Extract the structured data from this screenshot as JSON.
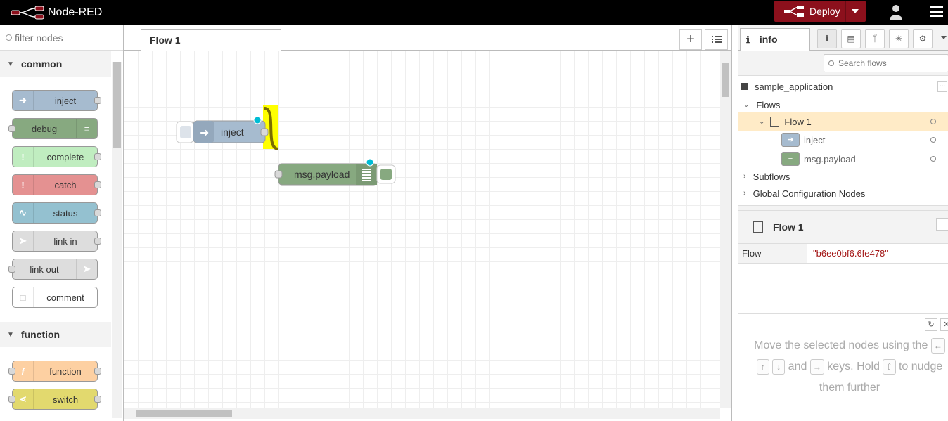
{
  "header": {
    "app_title": "Node-RED",
    "deploy_label": "Deploy"
  },
  "palette": {
    "filter_placeholder": "filter nodes",
    "categories": [
      {
        "name": "common",
        "nodes": [
          "inject",
          "debug",
          "complete",
          "catch",
          "status",
          "link in",
          "link out",
          "comment"
        ]
      },
      {
        "name": "function",
        "nodes": [
          "function",
          "switch"
        ]
      }
    ]
  },
  "workspace": {
    "tab_label": "Flow 1",
    "nodes": {
      "inject_label": "inject",
      "debug_label": "msg.payload"
    }
  },
  "sidebar": {
    "tab_label": "info",
    "search_placeholder": "Search flows",
    "tree": {
      "root": "sample_application",
      "flows_label": "Flows",
      "flow1_label": "Flow 1",
      "child1": "inject",
      "child2": "msg.payload",
      "subflows_label": "Subflows",
      "global_label": "Global Configuration Nodes"
    },
    "props": {
      "title": "Flow 1",
      "key": "Flow",
      "value": "\"b6ee0bf6.6fe478\""
    },
    "tips": {
      "part1": "Move the selected nodes using the",
      "key_left": "←",
      "key_up": "↑",
      "key_down": "↓",
      "and": "and",
      "key_right": "→",
      "part2": "keys. Hold",
      "key_shift": "⇧",
      "part3": "to nudge them further"
    }
  },
  "colors": {
    "inject": "#a6bbcf",
    "debug": "#87a980",
    "complete": "#c0edc0",
    "catch": "#e49191",
    "status": "#94c1d0",
    "link": "#dddddd",
    "function": "#fdd0a2",
    "switch": "#e2d96e",
    "deploy": "#8c101c",
    "selected_wire": "#ff0"
  }
}
